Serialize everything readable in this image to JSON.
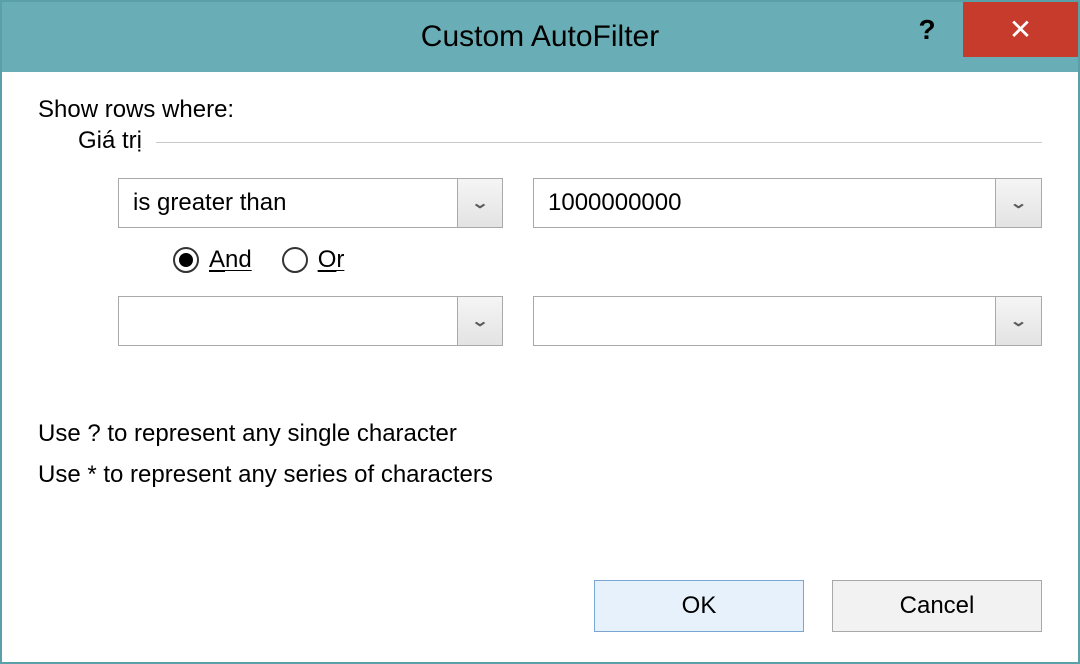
{
  "titlebar": {
    "title": "Custom AutoFilter",
    "help_icon": "?",
    "close_icon": "✕"
  },
  "content": {
    "show_rows_label": "Show rows where:",
    "fieldset_legend": "Giá trị",
    "row1": {
      "operator": "is greater than",
      "value": "1000000000"
    },
    "logic": {
      "and_label": "And",
      "or_label": "Or",
      "selected": "and"
    },
    "row2": {
      "operator": "",
      "value": ""
    },
    "hint1": "Use ? to represent any single character",
    "hint2": "Use * to represent any series of characters"
  },
  "buttons": {
    "ok": "OK",
    "cancel": "Cancel"
  }
}
